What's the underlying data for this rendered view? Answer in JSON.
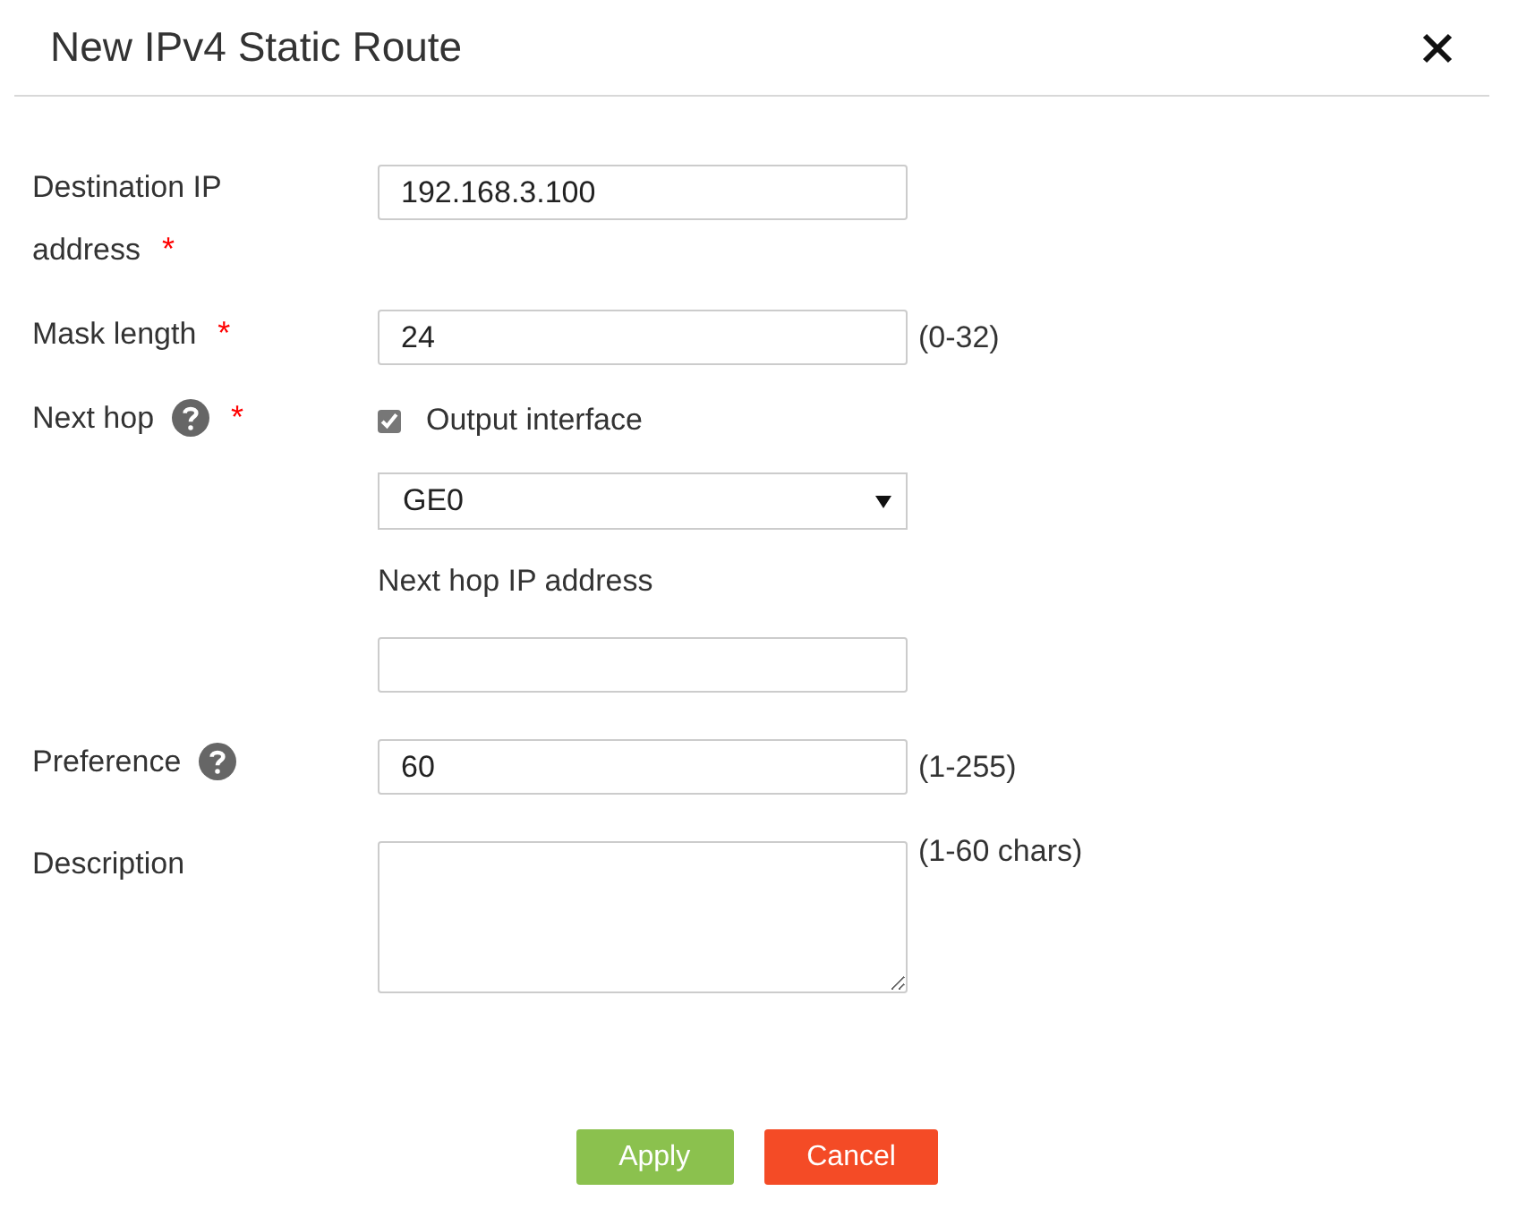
{
  "dialog": {
    "title": "New IPv4 Static Route"
  },
  "fields": [
    {
      "kind": "text",
      "label": "Destination IP address",
      "required_mark": "*",
      "value": "192.168.3.100"
    },
    {
      "kind": "text",
      "label": "Mask length",
      "required_mark": "*",
      "value": "24",
      "hint": "(0-32)"
    },
    {
      "kind": "next_hop",
      "label": "Next hop",
      "help": true,
      "required_mark": "*",
      "checkbox": {
        "label": "Output interface",
        "checked": true
      },
      "select": {
        "value": "GE0"
      },
      "ip": {
        "label": "Next hop IP address"
      }
    },
    {
      "kind": "text",
      "label": "Preference",
      "help": true,
      "value": "60",
      "hint": "(1-255)"
    },
    {
      "kind": "textarea",
      "label": "Description",
      "hint": "(1-60 chars)"
    }
  ],
  "buttons": [
    {
      "kind": "primary",
      "label": "Apply"
    },
    {
      "kind": "danger",
      "label": "Cancel"
    }
  ]
}
